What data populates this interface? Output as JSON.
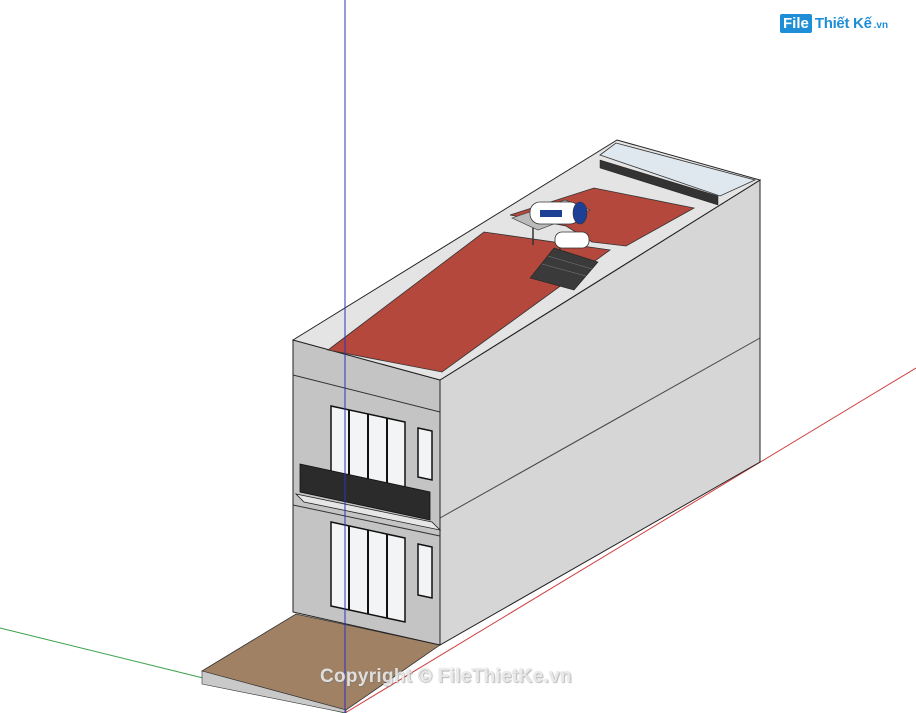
{
  "logo": {
    "prefix": "File",
    "name": "Thiết Kế",
    "suffix": ".vn"
  },
  "watermark": {
    "text": "Copyright © FileThietKe.vn"
  },
  "colors": {
    "roof": "#b5483c",
    "wall": "#d9d9d9",
    "wall_shadow": "#bdbdbd",
    "paving": "#a08164",
    "axis_red": "#d04040",
    "axis_green": "#3aa14a",
    "axis_blue": "#3030c0",
    "glass": "#dfe8ee"
  }
}
